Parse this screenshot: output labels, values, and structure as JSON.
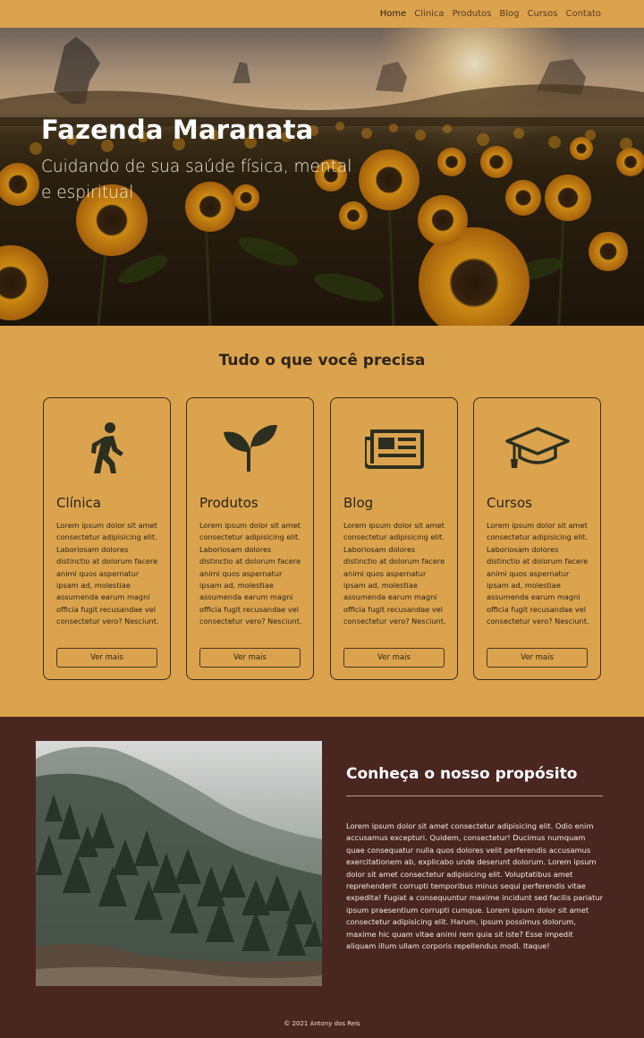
{
  "nav": {
    "items": [
      {
        "label": "Home",
        "active": true
      },
      {
        "label": "Clínica",
        "active": false
      },
      {
        "label": "Produtos",
        "active": false
      },
      {
        "label": "Blog",
        "active": false
      },
      {
        "label": "Cursos",
        "active": false
      },
      {
        "label": "Contato",
        "active": false
      }
    ]
  },
  "hero": {
    "title": "Fazenda Maranata",
    "subtitle": "Cuidando de sua saúde física, mental e espiritual"
  },
  "services": {
    "title": "Tudo o que você precisa",
    "cards": [
      {
        "icon": "walking-person-icon",
        "title": "Clínica",
        "text": "Lorem ipsum dolor sit amet consectetur adipisicing elit. Laboriosam dolores distinctio at dolorum facere animi quos aspernatur ipsam ad, molestiae assumenda earum magni officia fugit recusandae vel consectetur vero? Nesciunt.",
        "button": "Ver mais"
      },
      {
        "icon": "seedling-icon",
        "title": "Produtos",
        "text": "Lorem ipsum dolor sit amet consectetur adipisicing elit. Laboriosam dolores distinctio at dolorum facere animi quos aspernatur ipsam ad, molestiae assumenda earum magni officia fugit recusandae vel consectetur vero? Nesciunt.",
        "button": "Ver mais"
      },
      {
        "icon": "newspaper-icon",
        "title": "Blog",
        "text": "Lorem ipsum dolor sit amet consectetur adipisicing elit. Laboriosam dolores distinctio at dolorum facere animi quos aspernatur ipsam ad, molestiae assumenda earum magni officia fugit recusandae vel consectetur vero? Nesciunt.",
        "button": "Ver mais"
      },
      {
        "icon": "graduation-cap-icon",
        "title": "Cursos",
        "text": "Lorem ipsum dolor sit amet consectetur adipisicing elit. Laboriosam dolores distinctio at dolorum facere animi quos aspernatur ipsam ad, molestiae assumenda earum magni officia fugit recusandae vel consectetur vero? Nesciunt.",
        "button": "Ver mais"
      }
    ]
  },
  "purpose": {
    "title": "Conheça o nosso propósito",
    "text": "Lorem ipsum dolor sit amet consectetur adipisicing elit. Odio enim accusamus excepturi. Quidem, consectetur! Ducimus numquam quae consequatur nulla quos dolores velit perferendis accusamus exercitationem ab, explicabo unde deserunt dolorum. Lorem ipsum dolor sit amet consectetur adipisicing elit. Voluptatibus amet reprehenderit corrupti temporibus minus sequi perferendis vitae expedita! Fugiat a consequuntur maxime incidunt sed facilis pariatur ipsum praesentium corrupti cumque. Lorem ipsum dolor sit amet consectetur adipisicing elit. Harum, ipsum possimus dolorum, maxime hic quam vitae animi rem quia sit iste? Esse impedit aliquam illum ullam corporis repellendus modi. Itaque!"
  },
  "footer": {
    "text": "© 2021 Antony dos Reis"
  },
  "colors": {
    "accent": "#dba34d",
    "dark_brown": "#4a2621",
    "text_dark": "#2e2418"
  }
}
